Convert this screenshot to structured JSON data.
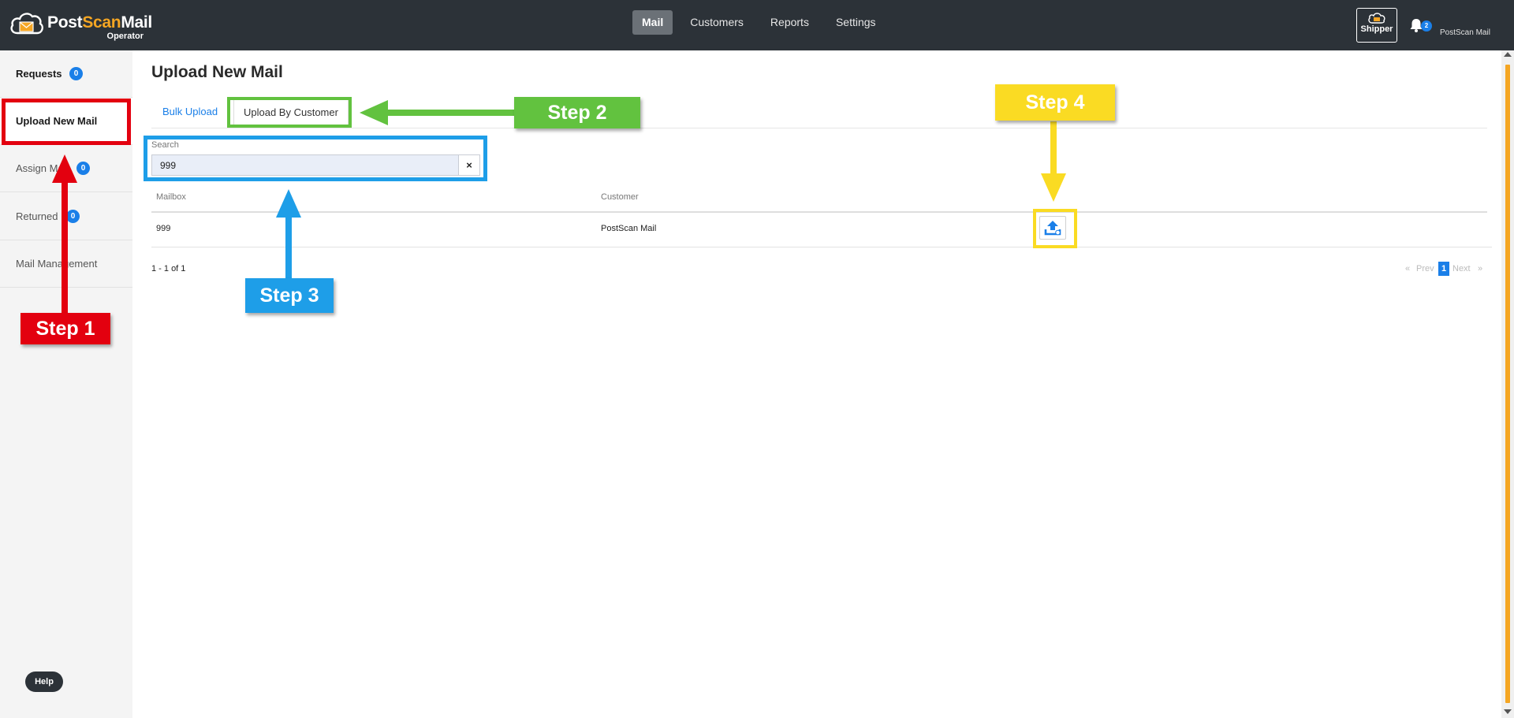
{
  "app": {
    "brand_part1": "Post",
    "brand_part2": "Scan",
    "brand_part3": "Mail",
    "subtitle": "Operator"
  },
  "topnav": {
    "mail": "Mail",
    "customers": "Customers",
    "reports": "Reports",
    "settings": "Settings",
    "active": "Mail"
  },
  "header": {
    "shipper_label": "Shipper",
    "notification_count": "2",
    "user_name": "PostScan Mail"
  },
  "sidebar": {
    "requests": "Requests",
    "requests_count": "0",
    "upload_new_mail": "Upload New Mail",
    "assign_mail": "Assign Mail",
    "assign_count": "0",
    "returned": "Returned",
    "returned_count": "0",
    "mail_management": "Mail Management",
    "help": "Help"
  },
  "main": {
    "title": "Upload New Mail",
    "tabs": {
      "bulk_upload": "Bulk Upload",
      "upload_by_customer": "Upload By Customer",
      "active": "Upload By Customer"
    },
    "search": {
      "label": "Search",
      "value": "999",
      "clear_label": "×"
    },
    "table": {
      "columns": [
        "Mailbox",
        "Customer"
      ],
      "rows": [
        {
          "mailbox": "999",
          "customer": "PostScan Mail"
        }
      ]
    },
    "pagination": {
      "range": "1 - 1 of 1",
      "first": "«",
      "prev": "Prev",
      "current": "1",
      "next": "Next",
      "last": "»"
    }
  },
  "annotations": {
    "step1": "Step 1",
    "step2": "Step 2",
    "step3": "Step 3",
    "step4": "Step 4",
    "colors": {
      "step1": "#e3000f",
      "step2": "#62c23f",
      "step3": "#1e9ee8",
      "step4": "#fadb23"
    }
  },
  "theme": {
    "topbar": "#2c3238",
    "accent": "#1a7fe8",
    "brand_orange": "#f5a623"
  }
}
